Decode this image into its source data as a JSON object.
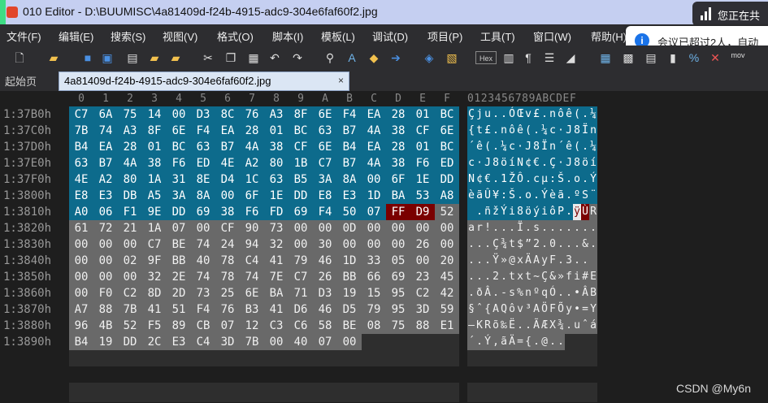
{
  "window": {
    "title": "010 Editor - D:\\BUUMISC\\4a81409d-f24b-4915-adc9-304e6faf60f2.jpg"
  },
  "notification_top": {
    "text": "您正在共"
  },
  "notification_meeting": {
    "text": "会议已超过2人，自动",
    "icon": "info-icon"
  },
  "menu": [
    "文件(F)",
    "编辑(E)",
    "搜索(S)",
    "视图(V)",
    "格式(O)",
    "脚本(I)",
    "模板(L)",
    "调试(D)",
    "项目(P)",
    "工具(T)",
    "窗口(W)",
    "帮助(H)"
  ],
  "toolbar": {
    "hex_label": "Hex",
    "mov_label": "mov"
  },
  "tabs": {
    "start_label": "起始页",
    "active_label": "4a81409d-f24b-4915-adc9-304e6faf60f2.jpg",
    "close_glyph": "×"
  },
  "hex_header": [
    "0",
    "1",
    "2",
    "3",
    "4",
    "5",
    "6",
    "7",
    "8",
    "9",
    "A",
    "B",
    "C",
    "D",
    "E",
    "F"
  ],
  "ascii_header": "0123456789ABCDEF",
  "rows": [
    {
      "addr": "1:37B0h",
      "hex": [
        "C7",
        "6A",
        "75",
        "14",
        "00",
        "D3",
        "8C",
        "76",
        "A3",
        "8F",
        "6E",
        "F4",
        "EA",
        "28",
        "01",
        "BC"
      ],
      "ascii": [
        "Ç",
        "j",
        "u",
        ".",
        ".",
        "Ó",
        "Œ",
        "v",
        "£",
        ".",
        "n",
        "ô",
        "ê",
        "(",
        ".",
        "¼"
      ],
      "style": [
        "s",
        "s",
        "s",
        "s",
        "s",
        "s",
        "s",
        "s",
        "s",
        "s",
        "s",
        "s",
        "s",
        "s",
        "s",
        "s"
      ]
    },
    {
      "addr": "1:37C0h",
      "hex": [
        "7B",
        "74",
        "A3",
        "8F",
        "6E",
        "F4",
        "EA",
        "28",
        "01",
        "BC",
        "63",
        "B7",
        "4A",
        "38",
        "CF",
        "6E"
      ],
      "ascii": [
        "{",
        "t",
        "£",
        ".",
        "n",
        "ô",
        "ê",
        "(",
        ".",
        "¼",
        "c",
        "·",
        "J",
        "8",
        "Ï",
        "n"
      ],
      "style": [
        "s",
        "s",
        "s",
        "s",
        "s",
        "s",
        "s",
        "s",
        "s",
        "s",
        "s",
        "s",
        "s",
        "s",
        "s",
        "s"
      ]
    },
    {
      "addr": "1:37D0h",
      "hex": [
        "B4",
        "EA",
        "28",
        "01",
        "BC",
        "63",
        "B7",
        "4A",
        "38",
        "CF",
        "6E",
        "B4",
        "EA",
        "28",
        "01",
        "BC"
      ],
      "ascii": [
        "´",
        "ê",
        "(",
        ".",
        "¼",
        "c",
        "·",
        "J",
        "8",
        "Ï",
        "n",
        "´",
        "ê",
        "(",
        ".",
        "¼"
      ],
      "style": [
        "s",
        "s",
        "s",
        "s",
        "s",
        "s",
        "s",
        "s",
        "s",
        "s",
        "s",
        "s",
        "s",
        "s",
        "s",
        "s"
      ]
    },
    {
      "addr": "1:37E0h",
      "hex": [
        "63",
        "B7",
        "4A",
        "38",
        "F6",
        "ED",
        "4E",
        "A2",
        "80",
        "1B",
        "C7",
        "B7",
        "4A",
        "38",
        "F6",
        "ED"
      ],
      "ascii": [
        "c",
        "·",
        "J",
        "8",
        "ö",
        "í",
        "N",
        "¢",
        "€",
        ".",
        "Ç",
        "·",
        "J",
        "8",
        "ö",
        "í"
      ],
      "style": [
        "s",
        "s",
        "s",
        "s",
        "s",
        "s",
        "s",
        "s",
        "s",
        "s",
        "s",
        "s",
        "s",
        "s",
        "s",
        "s"
      ]
    },
    {
      "addr": "1:37F0h",
      "hex": [
        "4E",
        "A2",
        "80",
        "1A",
        "31",
        "8E",
        "D4",
        "1C",
        "63",
        "B5",
        "3A",
        "8A",
        "00",
        "6F",
        "1E",
        "DD"
      ],
      "ascii": [
        "N",
        "¢",
        "€",
        ".",
        "1",
        "Ž",
        "Ô",
        ".",
        "c",
        "µ",
        ":",
        "Š",
        ".",
        "o",
        ".",
        "Ý"
      ],
      "style": [
        "s",
        "s",
        "s",
        "s",
        "s",
        "s",
        "s",
        "s",
        "s",
        "s",
        "s",
        "s",
        "s",
        "s",
        "s",
        "s"
      ]
    },
    {
      "addr": "1:3800h",
      "hex": [
        "E8",
        "E3",
        "DB",
        "A5",
        "3A",
        "8A",
        "00",
        "6F",
        "1E",
        "DD",
        "E8",
        "E3",
        "1D",
        "BA",
        "53",
        "A8"
      ],
      "ascii": [
        "è",
        "ã",
        "Û",
        "¥",
        ":",
        "Š",
        ".",
        "o",
        ".",
        "Ý",
        "è",
        "ã",
        ".",
        "º",
        "S",
        "¨"
      ],
      "style": [
        "s",
        "s",
        "s",
        "s",
        "s",
        "s",
        "s",
        "s",
        "s",
        "s",
        "s",
        "s",
        "s",
        "s",
        "s",
        "s"
      ]
    },
    {
      "addr": "1:3810h",
      "hex": [
        "A0",
        "06",
        "F1",
        "9E",
        "DD",
        "69",
        "38",
        "F6",
        "FD",
        "69",
        "F4",
        "50",
        "07",
        "FF",
        "D9",
        "52"
      ],
      "ascii": [
        " ",
        ".",
        "ñ",
        "ž",
        "Ý",
        "i",
        "8",
        "ö",
        "ý",
        "i",
        "ô",
        "P",
        ".",
        "ÿ",
        "Ù",
        "R"
      ],
      "style": [
        "s",
        "s",
        "s",
        "s",
        "s",
        "s",
        "s",
        "s",
        "s",
        "s",
        "s",
        "s",
        "s",
        "h",
        "h",
        "r"
      ]
    },
    {
      "addr": "1:3820h",
      "hex": [
        "61",
        "72",
        "21",
        "1A",
        "07",
        "00",
        "CF",
        "90",
        "73",
        "00",
        "00",
        "0D",
        "00",
        "00",
        "00",
        "00"
      ],
      "ascii": [
        "a",
        "r",
        "!",
        ".",
        ".",
        ".",
        "Ï",
        ".",
        "s",
        ".",
        ".",
        ".",
        ".",
        ".",
        ".",
        "."
      ],
      "style": [
        "r",
        "r",
        "r",
        "r",
        "r",
        "r",
        "r",
        "r",
        "r",
        "r",
        "r",
        "r",
        "r",
        "r",
        "r",
        "r"
      ]
    },
    {
      "addr": "1:3830h",
      "hex": [
        "00",
        "00",
        "00",
        "C7",
        "BE",
        "74",
        "24",
        "94",
        "32",
        "00",
        "30",
        "00",
        "00",
        "00",
        "26",
        "00"
      ],
      "ascii": [
        ".",
        ".",
        ".",
        "Ç",
        "¾",
        "t",
        "$",
        "”",
        "2",
        ".",
        "0",
        ".",
        ".",
        ".",
        "&",
        "."
      ],
      "style": [
        "r",
        "r",
        "r",
        "r",
        "r",
        "r",
        "r",
        "r",
        "r",
        "r",
        "r",
        "r",
        "r",
        "r",
        "r",
        "r"
      ]
    },
    {
      "addr": "1:3840h",
      "hex": [
        "00",
        "00",
        "02",
        "9F",
        "BB",
        "40",
        "78",
        "C4",
        "41",
        "79",
        "46",
        "1D",
        "33",
        "05",
        "00",
        "20"
      ],
      "ascii": [
        ".",
        ".",
        ".",
        "Ÿ",
        "»",
        "@",
        "x",
        "Ä",
        "A",
        "y",
        "F",
        ".",
        "3",
        ".",
        ".",
        " "
      ],
      "style": [
        "r",
        "r",
        "r",
        "r",
        "r",
        "r",
        "r",
        "r",
        "r",
        "r",
        "r",
        "r",
        "r",
        "r",
        "r",
        "r"
      ]
    },
    {
      "addr": "1:3850h",
      "hex": [
        "00",
        "00",
        "00",
        "32",
        "2E",
        "74",
        "78",
        "74",
        "7E",
        "C7",
        "26",
        "BB",
        "66",
        "69",
        "23",
        "45"
      ],
      "ascii": [
        ".",
        ".",
        ".",
        "2",
        ".",
        "t",
        "x",
        "t",
        "~",
        "Ç",
        "&",
        "»",
        "f",
        "i",
        "#",
        "E"
      ],
      "style": [
        "r",
        "r",
        "r",
        "r",
        "r",
        "r",
        "r",
        "r",
        "r",
        "r",
        "r",
        "r",
        "r",
        "r",
        "r",
        "r"
      ]
    },
    {
      "addr": "1:3860h",
      "hex": [
        "00",
        "F0",
        "C2",
        "8D",
        "2D",
        "73",
        "25",
        "6E",
        "BA",
        "71",
        "D3",
        "19",
        "15",
        "95",
        "C2",
        "42"
      ],
      "ascii": [
        ".",
        "ð",
        "Â",
        ".",
        "-",
        "s",
        "%",
        "n",
        "º",
        "q",
        "Ó",
        ".",
        ".",
        "•",
        "Â",
        "B"
      ],
      "style": [
        "r",
        "r",
        "r",
        "r",
        "r",
        "r",
        "r",
        "r",
        "r",
        "r",
        "r",
        "r",
        "r",
        "r",
        "r",
        "r"
      ]
    },
    {
      "addr": "1:3870h",
      "hex": [
        "A7",
        "88",
        "7B",
        "41",
        "51",
        "F4",
        "76",
        "B3",
        "41",
        "D6",
        "46",
        "D5",
        "79",
        "95",
        "3D",
        "59"
      ],
      "ascii": [
        "§",
        "ˆ",
        "{",
        "A",
        "Q",
        "ô",
        "v",
        "³",
        "A",
        "Ö",
        "F",
        "Õ",
        "y",
        "•",
        "=",
        "Y"
      ],
      "style": [
        "r",
        "r",
        "r",
        "r",
        "r",
        "r",
        "r",
        "r",
        "r",
        "r",
        "r",
        "r",
        "r",
        "r",
        "r",
        "r"
      ]
    },
    {
      "addr": "1:3880h",
      "hex": [
        "96",
        "4B",
        "52",
        "F5",
        "89",
        "CB",
        "07",
        "12",
        "C3",
        "C6",
        "58",
        "BE",
        "08",
        "75",
        "88",
        "E1"
      ],
      "ascii": [
        "–",
        "K",
        "R",
        "õ",
        "‰",
        "Ë",
        ".",
        ".",
        "Ã",
        "Æ",
        "X",
        "¾",
        ".",
        "u",
        "ˆ",
        "á"
      ],
      "style": [
        "r",
        "r",
        "r",
        "r",
        "r",
        "r",
        "r",
        "r",
        "r",
        "r",
        "r",
        "r",
        "r",
        "r",
        "r",
        "r"
      ]
    },
    {
      "addr": "1:3890h",
      "hex": [
        "B4",
        "19",
        "DD",
        "2C",
        "E3",
        "C4",
        "3D",
        "7B",
        "00",
        "40",
        "07",
        "00"
      ],
      "ascii": [
        "´",
        ".",
        "Ý",
        ",",
        "ã",
        "Ä",
        "=",
        "{",
        ".",
        "@",
        ".",
        " ."
      ],
      "style": [
        "r",
        "r",
        "r",
        "r",
        "r",
        "r",
        "r",
        "r",
        "r",
        "r",
        "r",
        "r"
      ]
    }
  ],
  "watermark": "CSDN @My6n"
}
